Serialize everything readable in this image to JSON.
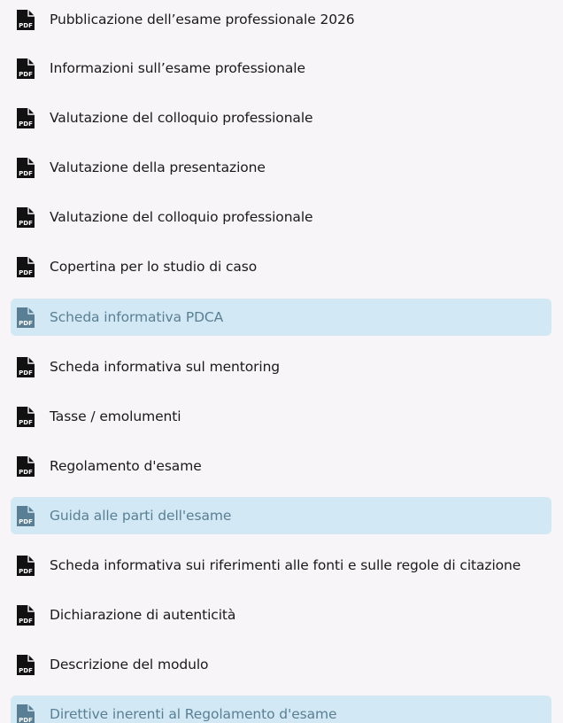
{
  "documents": [
    {
      "label": "Pubblicazione dell’esame professionale 2026",
      "icon": "pdf-file-icon",
      "highlighted": false
    },
    {
      "label": "Informazioni sull’esame professionale",
      "icon": "pdf-file-icon",
      "highlighted": false
    },
    {
      "label": "Valutazione del colloquio professionale",
      "icon": "pdf-file-icon",
      "highlighted": false
    },
    {
      "label": "Valutazione della presentazione",
      "icon": "pdf-file-icon",
      "highlighted": false
    },
    {
      "label": "Valutazione del colloquio professionale",
      "icon": "pdf-file-icon",
      "highlighted": false
    },
    {
      "label": "Copertina per lo studio di caso",
      "icon": "pdf-file-icon",
      "highlighted": false
    },
    {
      "label": "Scheda informativa PDCA",
      "icon": "pdf-file-icon",
      "highlighted": true
    },
    {
      "label": "Scheda informativa sul mentoring",
      "icon": "pdf-file-icon",
      "highlighted": false
    },
    {
      "label": "Tasse / emolumenti",
      "icon": "pdf-file-icon",
      "highlighted": false
    },
    {
      "label": "Regolamento d'esame",
      "icon": "pdf-file-icon",
      "highlighted": false
    },
    {
      "label": "Guida alle parti dell'esame",
      "icon": "pdf-file-icon",
      "highlighted": true
    },
    {
      "label": "Scheda informativa sui riferimenti alle fonti e sulle regole di citazione",
      "icon": "pdf-file-icon",
      "highlighted": false
    },
    {
      "label": "Dichiarazione di autenticità",
      "icon": "pdf-file-icon",
      "highlighted": false
    },
    {
      "label": "Descrizione del modulo",
      "icon": "pdf-file-icon",
      "highlighted": false
    },
    {
      "label": "Direttive inerenti al Regolamento d'esame",
      "icon": "pdf-file-icon",
      "highlighted": true
    }
  ],
  "pdf_badge_text": "PDF",
  "colors": {
    "background": "#f7f5f7",
    "highlight": "#d2e8f4",
    "text": "#1a1a1a",
    "highlight_text": "#5a7f94",
    "icon": "#111111",
    "highlight_icon": "#5a7f94"
  }
}
